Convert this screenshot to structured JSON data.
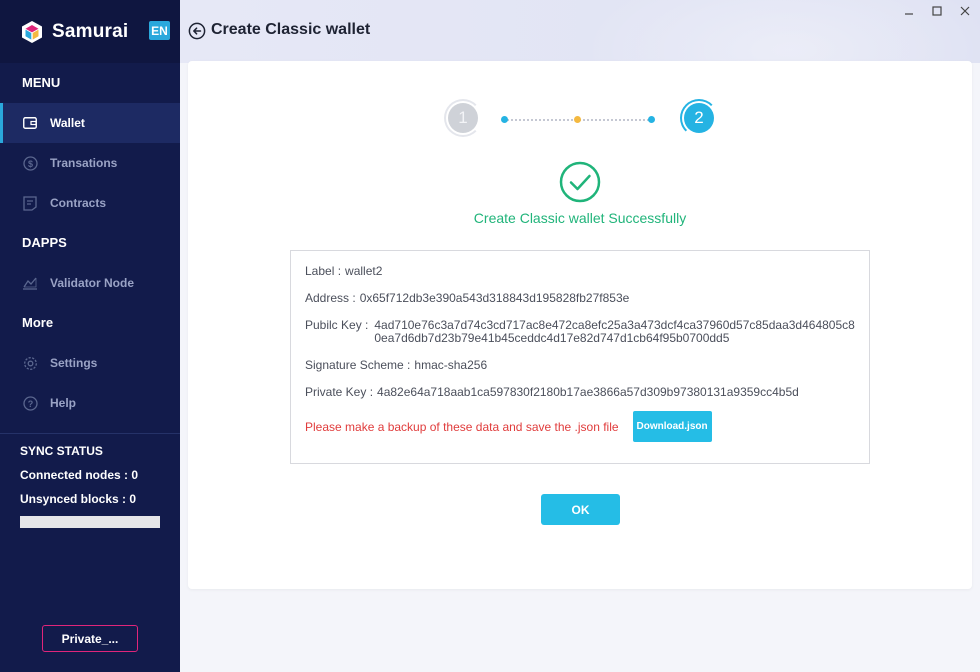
{
  "brand": {
    "name": "Samurai",
    "lang": "EN"
  },
  "sidebar": {
    "menu_title": "MENU",
    "items": [
      {
        "label": "Wallet",
        "icon": "wallet-icon"
      },
      {
        "label": "Transations",
        "icon": "dollar-circle-icon"
      },
      {
        "label": "Contracts",
        "icon": "document-icon"
      }
    ],
    "dapps_title": "DAPPS",
    "dapps_items": [
      {
        "label": "Validator Node",
        "icon": "validator-icon"
      }
    ],
    "more_title": "More",
    "more_items": [
      {
        "label": "Settings",
        "icon": "gear-icon"
      },
      {
        "label": "Help",
        "icon": "help-icon"
      }
    ],
    "sync": {
      "title": "SYNC STATUS",
      "connected_label": "Connected nodes : 0",
      "unsynced_label": "Unsynced blocks : 0"
    },
    "private_button": "Private_..."
  },
  "header": {
    "title": "Create Classic wallet"
  },
  "steps": {
    "step1": "1",
    "step2": "2"
  },
  "result": {
    "success_message": "Create Classic wallet Successfully",
    "label_key": "Label :",
    "label_value": "wallet2",
    "address_key": "Address :",
    "address_value": "0x65f712db3e390a543d318843d195828fb27f853e",
    "public_key_key": "Pubilc Key :",
    "public_key_value": "4ad710e76c3a7d74c3cd717ac8e472ca8efc25a3a473dcf4ca37960d57c85daa3d464805c80ea7d6db7d23b79e41b45ceddc4d17e82d747d1cb64f95b0700dd5",
    "signature_key": "Signature Scheme :",
    "signature_value": "hmac-sha256",
    "private_key_key": "Private Key :",
    "private_key_value": "4a82e64a718aab1ca597830f2180b17ae3866a57d309b97380131a9359cc4b5d",
    "warning": "Please make a backup of these data and save the .json file",
    "download_label": "Download.json"
  },
  "ok_label": "OK",
  "colors": {
    "sidebar_bg": "#121b4b",
    "accent": "#25bde6",
    "success": "#20b47a",
    "warning": "#e03c3c",
    "private_border": "#e0257a"
  }
}
